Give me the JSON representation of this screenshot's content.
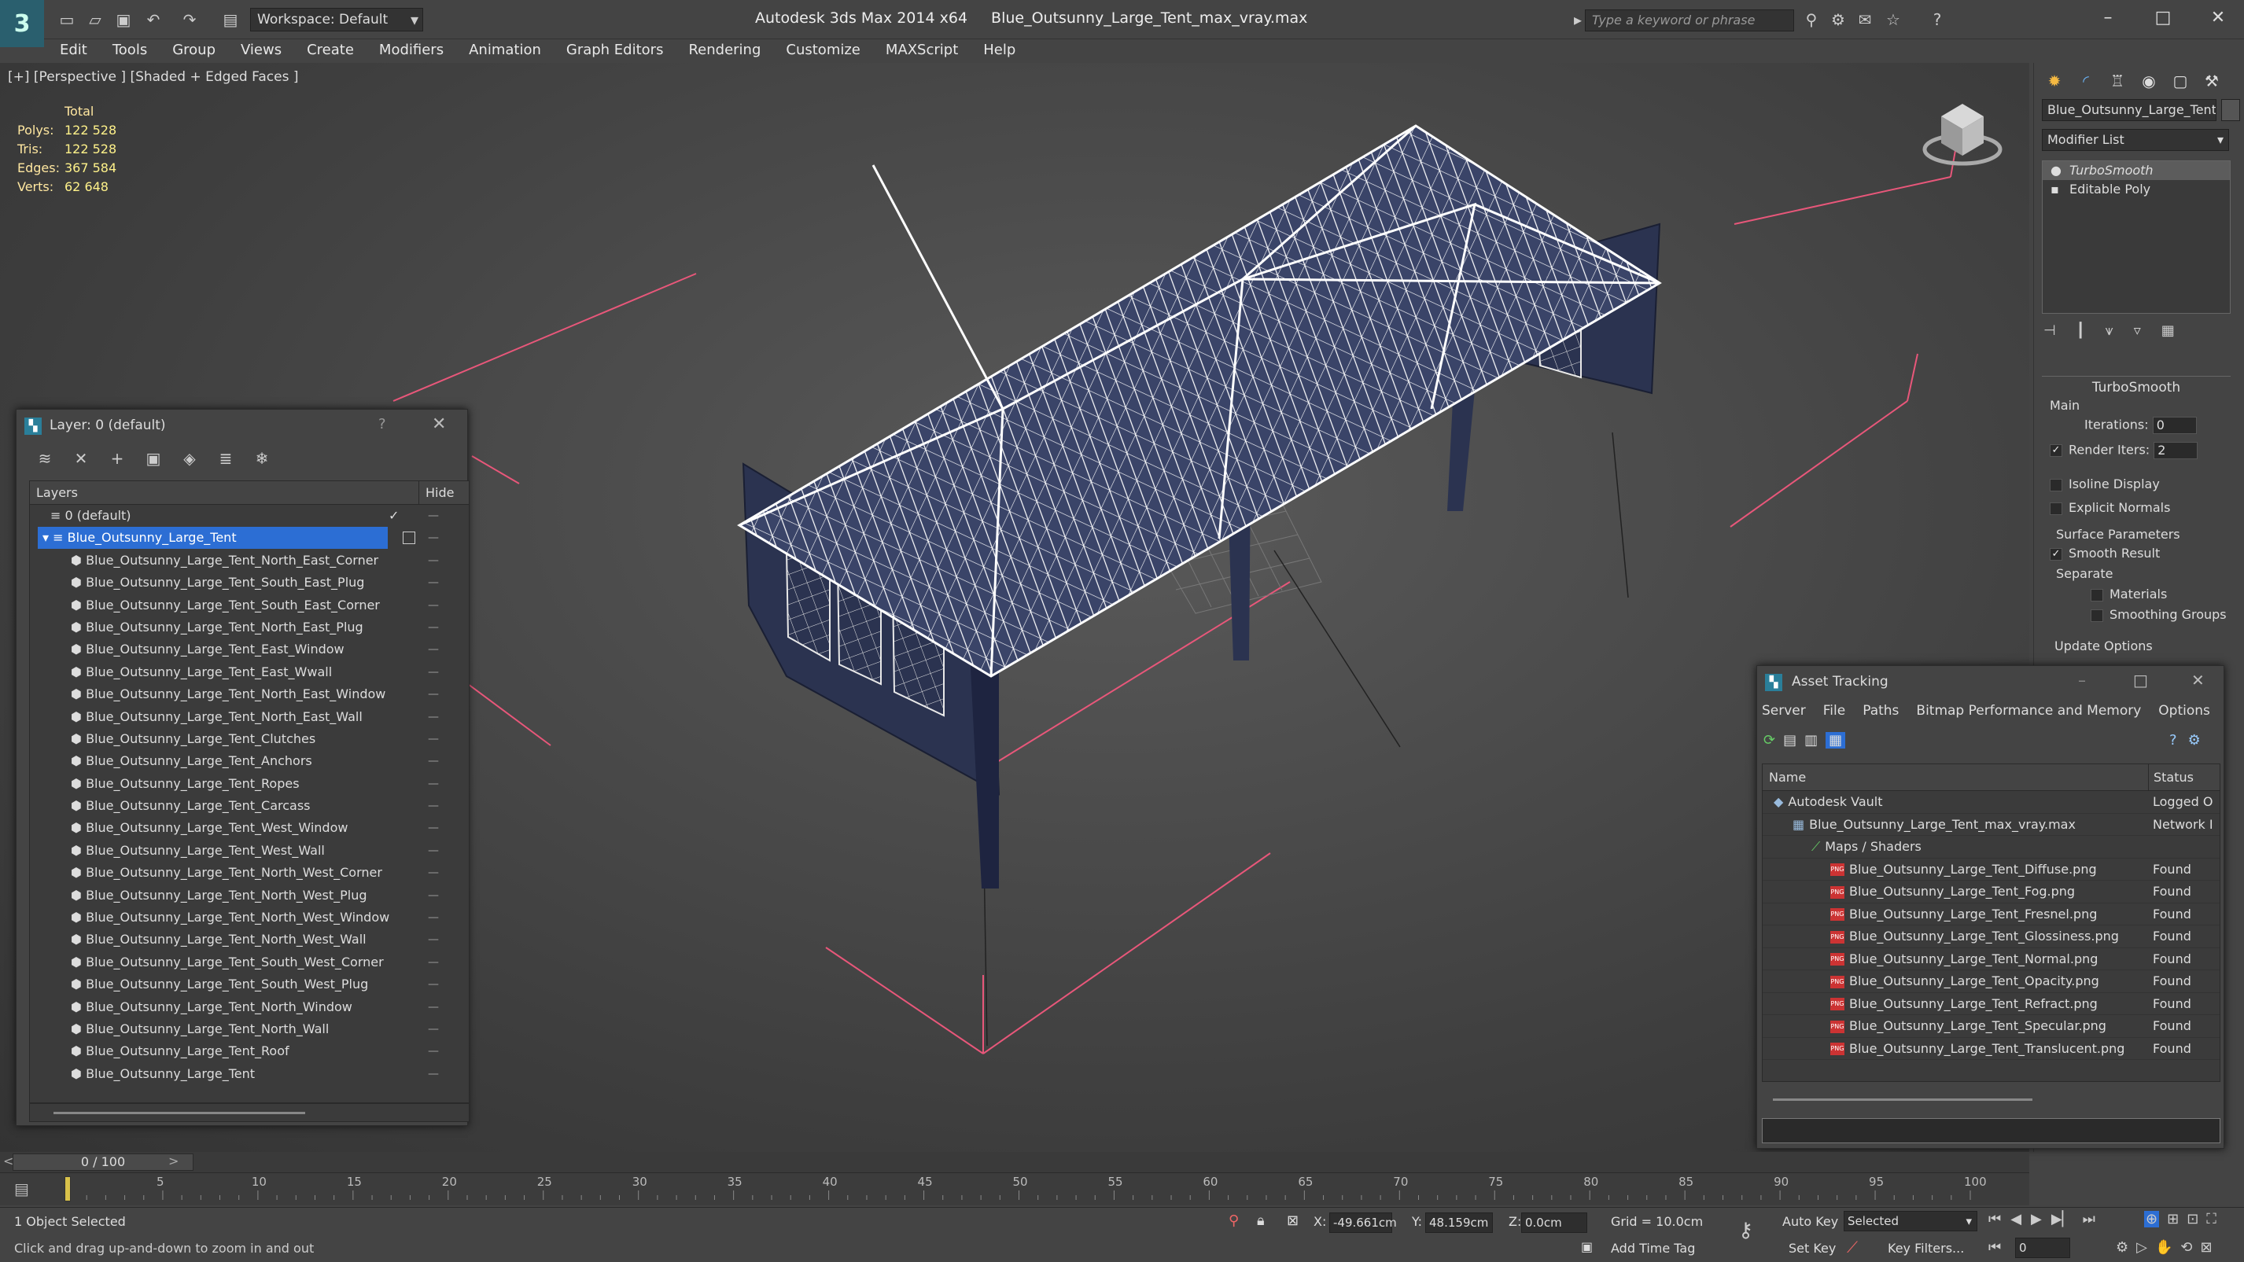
{
  "titlebar": {
    "workspace": "Workspace: Default",
    "app": "Autodesk 3ds Max  2014 x64",
    "file": "Blue_Outsunny_Large_Tent_max_vray.max",
    "search_placeholder": "Type a keyword or phrase"
  },
  "menu": [
    "Edit",
    "Tools",
    "Group",
    "Views",
    "Create",
    "Modifiers",
    "Animation",
    "Graph Editors",
    "Rendering",
    "Customize",
    "MAXScript",
    "Help"
  ],
  "viewport": {
    "label": "[+] [Perspective ] [Shaded + Edged Faces ]",
    "stats": {
      "header": "Total",
      "rows": [
        {
          "k": "Polys:",
          "v": "122 528"
        },
        {
          "k": "Tris:",
          "v": "122 528"
        },
        {
          "k": "Edges:",
          "v": "367 584"
        },
        {
          "k": "Verts:",
          "v": "62 648"
        }
      ]
    }
  },
  "command_panel": {
    "object_name": "Blue_Outsunny_Large_Tent_",
    "modifier_list": "Modifier List",
    "stack": [
      "TurboSmooth",
      "Editable Poly"
    ],
    "turbosmooth": {
      "title": "TurboSmooth",
      "main": "Main",
      "iterations_label": "Iterations:",
      "iterations": "0",
      "render_iters_label": "Render Iters:",
      "render_iters": "2",
      "isoline": "Isoline Display",
      "explicit": "Explicit Normals",
      "surface": "Surface Parameters",
      "smooth_result": "Smooth Result",
      "separate": "Separate",
      "materials": "Materials",
      "smoothing_groups": "Smoothing Groups",
      "update": "Update Options"
    }
  },
  "layer_panel": {
    "title": "Layer: 0 (default)",
    "help": "?",
    "col_layers": "Layers",
    "col_hide": "Hide",
    "default_layer": "0 (default)",
    "selected_layer": "Blue_Outsunny_Large_Tent",
    "objects": [
      "Blue_Outsunny_Large_Tent_North_East_Corner",
      "Blue_Outsunny_Large_Tent_South_East_Plug",
      "Blue_Outsunny_Large_Tent_South_East_Corner",
      "Blue_Outsunny_Large_Tent_North_East_Plug",
      "Blue_Outsunny_Large_Tent_East_Window",
      "Blue_Outsunny_Large_Tent_East_Wwall",
      "Blue_Outsunny_Large_Tent_North_East_Window",
      "Blue_Outsunny_Large_Tent_North_East_Wall",
      "Blue_Outsunny_Large_Tent_Clutches",
      "Blue_Outsunny_Large_Tent_Anchors",
      "Blue_Outsunny_Large_Tent_Ropes",
      "Blue_Outsunny_Large_Tent_Carcass",
      "Blue_Outsunny_Large_Tent_West_Window",
      "Blue_Outsunny_Large_Tent_West_Wall",
      "Blue_Outsunny_Large_Tent_North_West_Corner",
      "Blue_Outsunny_Large_Tent_North_West_Plug",
      "Blue_Outsunny_Large_Tent_North_West_Window",
      "Blue_Outsunny_Large_Tent_North_West_Wall",
      "Blue_Outsunny_Large_Tent_South_West_Corner",
      "Blue_Outsunny_Large_Tent_South_West_Plug",
      "Blue_Outsunny_Large_Tent_North_Window",
      "Blue_Outsunny_Large_Tent_North_Wall",
      "Blue_Outsunny_Large_Tent_Roof",
      "Blue_Outsunny_Large_Tent"
    ]
  },
  "asset_panel": {
    "title": "Asset Tracking",
    "menu": [
      "Server",
      "File",
      "Paths",
      "Bitmap Performance and Memory",
      "Options"
    ],
    "col_name": "Name",
    "col_status": "Status",
    "rows": [
      {
        "name": "Autodesk Vault",
        "status": "Logged O",
        "indent": 1,
        "kind": "vault"
      },
      {
        "name": "Blue_Outsunny_Large_Tent_max_vray.max",
        "status": "Network I",
        "indent": 2,
        "kind": "max"
      },
      {
        "name": "Maps / Shaders",
        "status": "",
        "indent": 3,
        "kind": "maps"
      },
      {
        "name": "Blue_Outsunny_Large_Tent_Diffuse.png",
        "status": "Found",
        "indent": 4,
        "kind": "png"
      },
      {
        "name": "Blue_Outsunny_Large_Tent_Fog.png",
        "status": "Found",
        "indent": 4,
        "kind": "png"
      },
      {
        "name": "Blue_Outsunny_Large_Tent_Fresnel.png",
        "status": "Found",
        "indent": 4,
        "kind": "png"
      },
      {
        "name": "Blue_Outsunny_Large_Tent_Glossiness.png",
        "status": "Found",
        "indent": 4,
        "kind": "png"
      },
      {
        "name": "Blue_Outsunny_Large_Tent_Normal.png",
        "status": "Found",
        "indent": 4,
        "kind": "png"
      },
      {
        "name": "Blue_Outsunny_Large_Tent_Opacity.png",
        "status": "Found",
        "indent": 4,
        "kind": "png"
      },
      {
        "name": "Blue_Outsunny_Large_Tent_Refract.png",
        "status": "Found",
        "indent": 4,
        "kind": "png"
      },
      {
        "name": "Blue_Outsunny_Large_Tent_Specular.png",
        "status": "Found",
        "indent": 4,
        "kind": "png"
      },
      {
        "name": "Blue_Outsunny_Large_Tent_Translucent.png",
        "status": "Found",
        "indent": 4,
        "kind": "png"
      }
    ]
  },
  "timeline": {
    "frame": "0 / 100",
    "ticks": [
      "5",
      "10",
      "15",
      "20",
      "25",
      "30",
      "35",
      "40",
      "45",
      "50",
      "55",
      "60",
      "65",
      "70",
      "75",
      "80",
      "85",
      "90",
      "95",
      "100"
    ]
  },
  "status": {
    "selected": "1 Object Selected",
    "hint": "Click and drag up-and-down to zoom in and out",
    "x_label": "X:",
    "x": "-49.661cm",
    "y_label": "Y:",
    "y": "48.159cm",
    "z_label": "Z:",
    "z": "0.0cm",
    "grid": "Grid = 10.0cm",
    "auto_key": "Auto Key",
    "selected_set": "Selected",
    "set_key": "Set Key",
    "key_filters": "Key Filters...",
    "add_time_tag": "Add Time Tag",
    "frame_field": "0"
  },
  "colors": {
    "accent": "#2c6ed4",
    "tent_blue": "#2b3350",
    "wire": "#ffffff",
    "guide": "#e8577a"
  }
}
